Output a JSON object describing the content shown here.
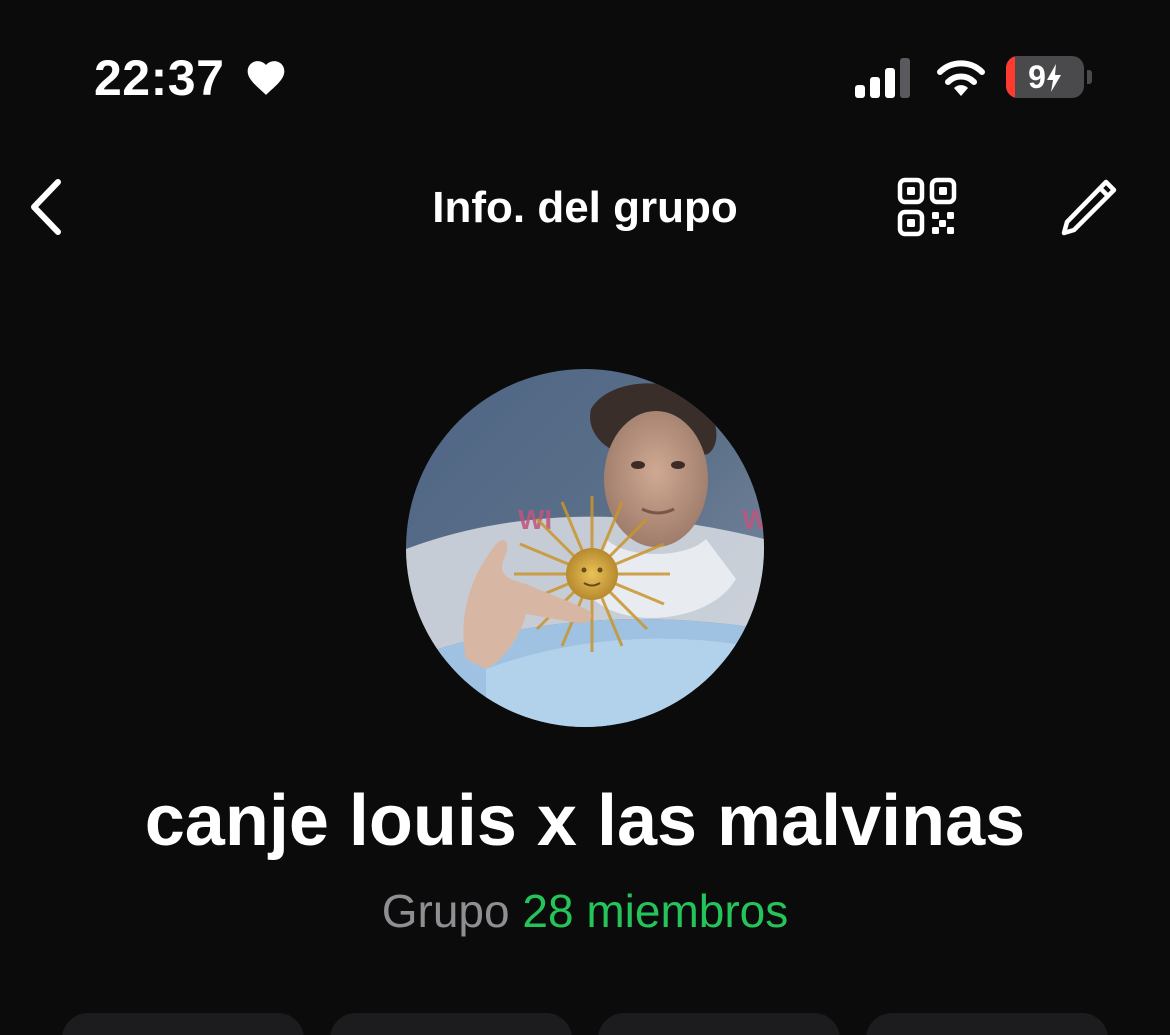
{
  "status_bar": {
    "time": "22:37",
    "battery_level": "9",
    "icons": [
      "heart-icon",
      "signal-icon",
      "wifi-icon",
      "battery-icon",
      "charging-bolt-icon"
    ],
    "battery_color": "#ff3b30"
  },
  "nav": {
    "title": "Info. del grupo",
    "icons": [
      "chevron-left-icon",
      "qr-code-icon",
      "pencil-icon"
    ]
  },
  "group": {
    "name": "canje louis x las malvinas",
    "type_label": "Grupo",
    "members_label": "28 miembros",
    "members_color": "#25c45a"
  },
  "actions": {
    "count_visible": 4
  }
}
